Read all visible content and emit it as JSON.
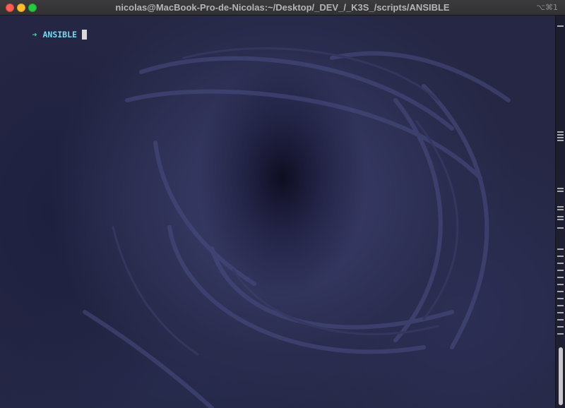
{
  "window": {
    "title": "nicolas@MacBook-Pro-de-Nicolas:~/Desktop/_DEV_/_K3S_/scripts/ANSIBLE",
    "shortcut": "⌥⌘1"
  },
  "terminal": {
    "prompt_symbol": "➜",
    "current_dir": "ANSIBLE",
    "input": ""
  },
  "colors": {
    "prompt_symbol": "#4fd1a6",
    "current_dir": "#7fd6f0",
    "titlebar": "#353537",
    "background": "#252744"
  }
}
